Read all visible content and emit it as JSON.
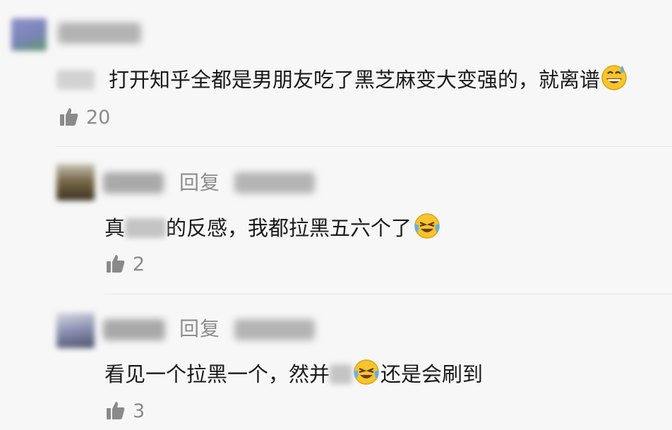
{
  "comments": [
    {
      "text": "打开知乎全都是男朋友吃了黑芝麻变大变强的，就离谱",
      "emoji": "grinning-sweat-emoji",
      "likes": "20"
    },
    {
      "reply_label": "回复",
      "text_part1": "真",
      "text_part2": "的反感，我都拉黑五六个了",
      "emoji": "crying-laughing-emoji",
      "likes": "2"
    },
    {
      "reply_label": "回复",
      "text_part1": "看见一个拉黑一个，然并",
      "text_part2": "还是会刷到",
      "emoji": "crying-laughing-emoji",
      "likes": "3"
    }
  ],
  "colors": {
    "background": "#f7f7f7",
    "text": "#1a1a1a",
    "meta": "#8a8a8a"
  }
}
